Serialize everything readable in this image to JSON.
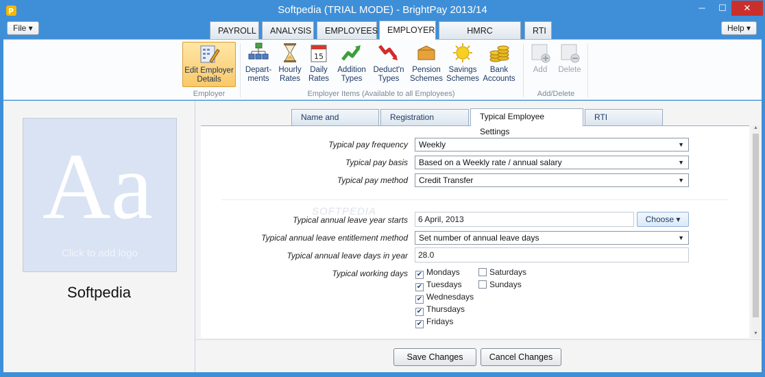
{
  "window": {
    "title": "Softpedia (TRIAL MODE) - BrightPay 2013/14",
    "minimize": "─",
    "maximize": "☐",
    "close": "✕"
  },
  "menus": {
    "file": "File ▾",
    "help": "Help ▾"
  },
  "main_tabs": [
    "PAYROLL",
    "ANALYSIS",
    "EMPLOYEES",
    "EMPLOYER",
    "HMRC PAYMENTS",
    "RTI"
  ],
  "ribbon": {
    "edit_employer": "Edit Employer Details",
    "edit_employer_l1": "Edit Employer",
    "edit_employer_l2": "Details",
    "items": [
      {
        "l1": "Depart-",
        "l2": "ments",
        "icon": "departments-icon"
      },
      {
        "l1": "Hourly",
        "l2": "Rates",
        "icon": "hourglass-icon"
      },
      {
        "l1": "Daily",
        "l2": "Rates",
        "icon": "calendar-icon"
      },
      {
        "l1": "Addition",
        "l2": "Types",
        "icon": "addition-arrow-icon"
      },
      {
        "l1": "Deduct'n",
        "l2": "Types",
        "icon": "deduction-arrow-icon"
      },
      {
        "l1": "Pension",
        "l2": "Schemes",
        "icon": "pension-box-icon"
      },
      {
        "l1": "Savings",
        "l2": "Schemes",
        "icon": "savings-sun-icon"
      },
      {
        "l1": "Bank",
        "l2": "Accounts",
        "icon": "coins-icon"
      }
    ],
    "add": "Add",
    "delete": "Delete",
    "groups": {
      "employer": "Employer",
      "items": "Employer Items (Available to all Employees)",
      "add_delete": "Add/Delete"
    }
  },
  "left": {
    "logo_letters": "Aa",
    "logo_hint": "Click to add logo",
    "company": "Softpedia"
  },
  "sub_tabs": [
    "Name and Address",
    "Registration Details",
    "Typical Employee Settings",
    "RTI Submissions"
  ],
  "form": {
    "pay_frequency": {
      "label": "Typical pay frequency",
      "value": "Weekly"
    },
    "pay_basis": {
      "label": "Typical pay basis",
      "value": "Based on a Weekly rate / annual salary"
    },
    "pay_method": {
      "label": "Typical pay method",
      "value": "Credit Transfer"
    },
    "leave_year_starts": {
      "label": "Typical annual leave year starts",
      "value": "6 April, 2013",
      "button": "Choose ▾"
    },
    "leave_method": {
      "label": "Typical annual leave entitlement method",
      "value": "Set number of annual leave days"
    },
    "leave_days": {
      "label": "Typical annual leave days in year",
      "value": "28.0"
    },
    "working_days": {
      "label": "Typical working days",
      "days": [
        {
          "name": "Mondays",
          "checked": true
        },
        {
          "name": "Tuesdays",
          "checked": true
        },
        {
          "name": "Wednesdays",
          "checked": true
        },
        {
          "name": "Thursdays",
          "checked": true
        },
        {
          "name": "Fridays",
          "checked": true
        },
        {
          "name": "Saturdays",
          "checked": false
        },
        {
          "name": "Sundays",
          "checked": false
        }
      ]
    }
  },
  "actions": {
    "save": "Save Changes",
    "cancel": "Cancel Changes"
  },
  "watermark": "SOFTPEDIA",
  "colors": {
    "titlebar": "#3e8fd8",
    "close": "#c9302c",
    "selected_ribbon": "#f9c96a"
  }
}
